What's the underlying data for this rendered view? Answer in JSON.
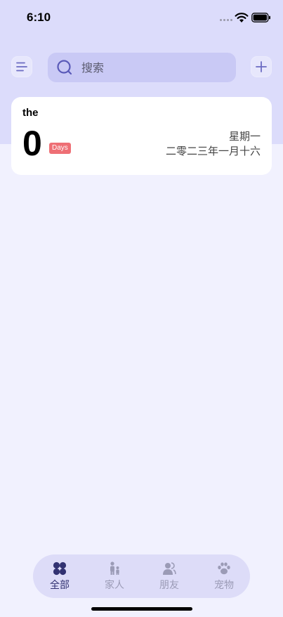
{
  "status_bar": {
    "time": "6:10"
  },
  "search": {
    "placeholder": "搜索"
  },
  "card": {
    "title": "the",
    "count": "0",
    "badge": "Days",
    "weekday": "星期一",
    "date": "二零二三年一月十六"
  },
  "tabs": [
    {
      "label": "全部",
      "icon": "four-petal-icon",
      "active": true
    },
    {
      "label": "家人",
      "icon": "family-icon",
      "active": false
    },
    {
      "label": "朋友",
      "icon": "friends-icon",
      "active": false
    },
    {
      "label": "宠物",
      "icon": "paw-icon",
      "active": false
    }
  ],
  "colors": {
    "header_bg": "#dcdcfb",
    "page_bg": "#f1f1fe",
    "badge": "#ee6f75",
    "accent": "#323272",
    "search_bg": "#c9c9f5"
  }
}
